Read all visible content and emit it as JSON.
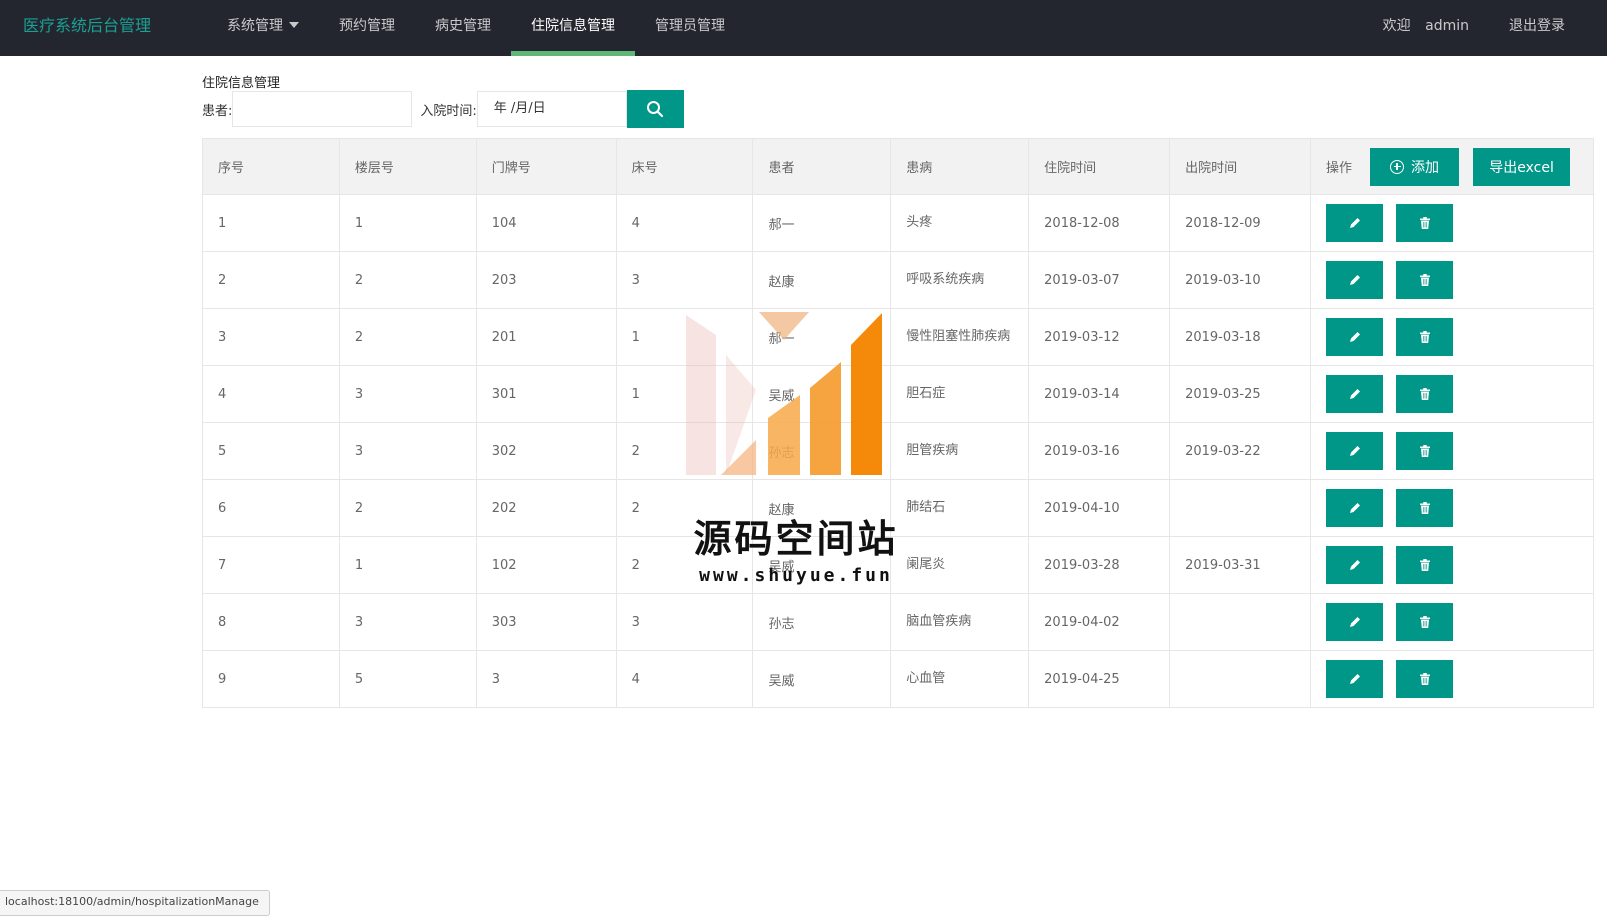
{
  "nav": {
    "brand": "医疗系统后台管理",
    "items": [
      {
        "label": "系统管理"
      },
      {
        "label": "预约管理"
      },
      {
        "label": "病史管理"
      },
      {
        "label": "住院信息管理"
      },
      {
        "label": "管理员管理"
      }
    ],
    "welcome": "欢迎",
    "user": "admin",
    "logout": "退出登录",
    "active_color": "#5fb878",
    "bg_color": "#23262e"
  },
  "page": {
    "title": "住院信息管理",
    "search": {
      "patient_label": "患者:",
      "patient_value": "",
      "admit_label": "入院时间:",
      "admit_placeholder": "年 /月/日"
    }
  },
  "table": {
    "headers": [
      "序号",
      "楼层号",
      "门牌号",
      "床号",
      "患者",
      "患病",
      "住院时间",
      "出院时间"
    ],
    "op_header": "操作",
    "add_label": "添加",
    "export_label": "导出excel",
    "rows": [
      {
        "id": "1",
        "floor": "1",
        "room": "104",
        "bed": "4",
        "patient": "郝一",
        "disease": "头疼",
        "admit": "2018-12-08",
        "discharge": "2018-12-09"
      },
      {
        "id": "2",
        "floor": "2",
        "room": "203",
        "bed": "3",
        "patient": "赵康",
        "disease": "呼吸系统疾病",
        "admit": "2019-03-07",
        "discharge": "2019-03-10"
      },
      {
        "id": "3",
        "floor": "2",
        "room": "201",
        "bed": "1",
        "patient": "郝一",
        "disease": "慢性阻塞性肺疾病",
        "admit": "2019-03-12",
        "discharge": "2019-03-18"
      },
      {
        "id": "4",
        "floor": "3",
        "room": "301",
        "bed": "1",
        "patient": "吴威",
        "disease": "胆石症",
        "admit": "2019-03-14",
        "discharge": "2019-03-25"
      },
      {
        "id": "5",
        "floor": "3",
        "room": "302",
        "bed": "2",
        "patient": "孙志",
        "disease": "胆管疾病",
        "admit": "2019-03-16",
        "discharge": "2019-03-22"
      },
      {
        "id": "6",
        "floor": "2",
        "room": "202",
        "bed": "2",
        "patient": "赵康",
        "disease": "肺结石",
        "admit": "2019-04-10",
        "discharge": ""
      },
      {
        "id": "7",
        "floor": "1",
        "room": "102",
        "bed": "2",
        "patient": "吴威",
        "disease": "阑尾炎",
        "admit": "2019-03-28",
        "discharge": "2019-03-31"
      },
      {
        "id": "8",
        "floor": "3",
        "room": "303",
        "bed": "3",
        "patient": "孙志",
        "disease": "脑血管疾病",
        "admit": "2019-04-02",
        "discharge": ""
      },
      {
        "id": "9",
        "floor": "5",
        "room": "3",
        "bed": "4",
        "patient": "吴威",
        "disease": "心血管",
        "admit": "2019-04-25",
        "discharge": ""
      }
    ]
  },
  "icons": {
    "search": "search-icon",
    "add": "plus-circle-icon",
    "edit": "pencil-icon",
    "delete": "trash-icon"
  },
  "accent_color": "#009688",
  "watermark": {
    "text": "源码空间站",
    "url": "www.shuyue.fun"
  },
  "status_url": "localhost:18100/admin/hospitalizationManage"
}
